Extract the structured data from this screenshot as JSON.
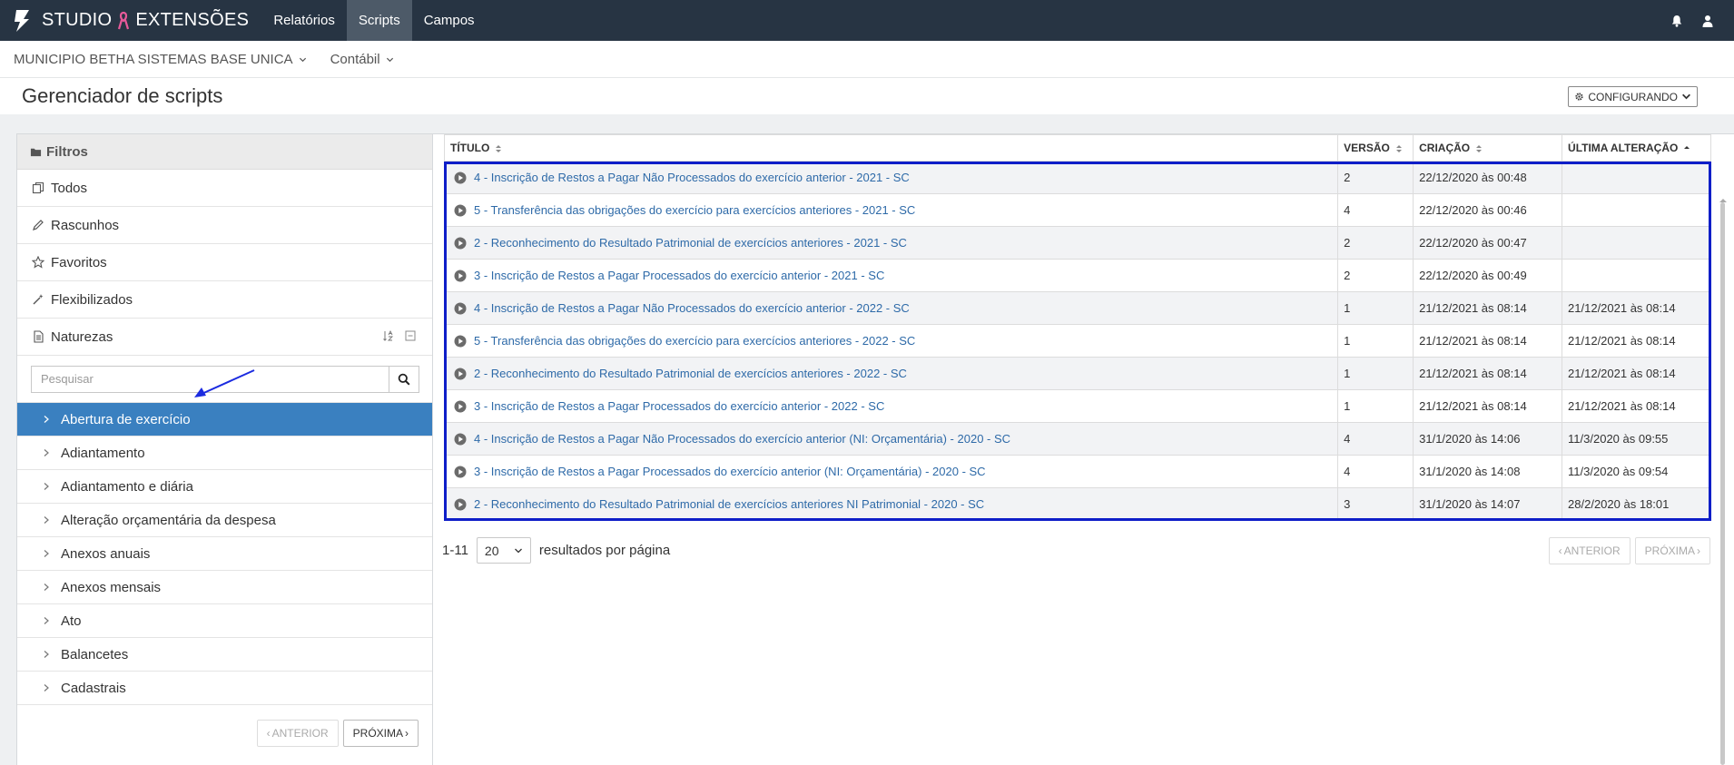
{
  "app": {
    "brand_left": "STUDIO",
    "brand_right": "EXTENSÕES",
    "nav": [
      {
        "label": "Relatórios",
        "active": false
      },
      {
        "label": "Scripts",
        "active": true
      },
      {
        "label": "Campos",
        "active": false
      }
    ]
  },
  "context": {
    "entity": "MUNICIPIO BETHA SISTEMAS BASE UNICA",
    "system": "Contábil"
  },
  "page": {
    "title": "Gerenciador de scripts",
    "config_label": "CONFIGURANDO"
  },
  "sidebar": {
    "header": "Filtros",
    "items": [
      {
        "label": "Todos",
        "icon": "copy-icon"
      },
      {
        "label": "Rascunhos",
        "icon": "pencil-icon"
      },
      {
        "label": "Favoritos",
        "icon": "star-icon"
      },
      {
        "label": "Flexibilizados",
        "icon": "wand-icon"
      },
      {
        "label": "Naturezas",
        "icon": "file-icon"
      }
    ],
    "search_placeholder": "Pesquisar",
    "tree": [
      {
        "label": "Abertura de exercício",
        "selected": true
      },
      {
        "label": "Adiantamento",
        "selected": false
      },
      {
        "label": "Adiantamento e diária",
        "selected": false
      },
      {
        "label": "Alteração orçamentária da despesa",
        "selected": false
      },
      {
        "label": "Anexos anuais",
        "selected": false
      },
      {
        "label": "Anexos mensais",
        "selected": false
      },
      {
        "label": "Ato",
        "selected": false
      },
      {
        "label": "Balancetes",
        "selected": false
      },
      {
        "label": "Cadastrais",
        "selected": false
      }
    ],
    "pager": {
      "prev": "ANTERIOR",
      "next": "PRÓXIMA"
    }
  },
  "table": {
    "columns": [
      "TÍTULO",
      "VERSÃO",
      "CRIAÇÃO",
      "ÚLTIMA ALTERAÇÃO"
    ],
    "rows": [
      {
        "title": "4 - Inscrição de Restos a Pagar Não Processados do exercício anterior - 2021 - SC",
        "version": "2",
        "created": "22/12/2020 às 00:48",
        "modified": ""
      },
      {
        "title": "5 - Transferência das obrigações do exercício para exercícios anteriores - 2021 - SC",
        "version": "4",
        "created": "22/12/2020 às 00:46",
        "modified": ""
      },
      {
        "title": "2 - Reconhecimento do Resultado Patrimonial de exercícios anteriores - 2021 - SC",
        "version": "2",
        "created": "22/12/2020 às 00:47",
        "modified": ""
      },
      {
        "title": "3 - Inscrição de Restos a Pagar Processados do exercício anterior - 2021 - SC",
        "version": "2",
        "created": "22/12/2020 às 00:49",
        "modified": ""
      },
      {
        "title": "4 - Inscrição de Restos a Pagar Não Processados do exercício anterior - 2022 - SC",
        "version": "1",
        "created": "21/12/2021 às 08:14",
        "modified": "21/12/2021 às 08:14"
      },
      {
        "title": "5 - Transferência das obrigações do exercício para exercícios anteriores - 2022 - SC",
        "version": "1",
        "created": "21/12/2021 às 08:14",
        "modified": "21/12/2021 às 08:14"
      },
      {
        "title": "2 - Reconhecimento do Resultado Patrimonial de exercícios anteriores - 2022 - SC",
        "version": "1",
        "created": "21/12/2021 às 08:14",
        "modified": "21/12/2021 às 08:14"
      },
      {
        "title": "3 - Inscrição de Restos a Pagar Processados do exercício anterior - 2022 - SC",
        "version": "1",
        "created": "21/12/2021 às 08:14",
        "modified": "21/12/2021 às 08:14"
      },
      {
        "title": "4 - Inscrição de Restos a Pagar Não Processados do exercício anterior (NI: Orçamentária) - 2020 - SC",
        "version": "4",
        "created": "31/1/2020 às 14:06",
        "modified": "11/3/2020 às 09:55"
      },
      {
        "title": "3 - Inscrição de Restos a Pagar Processados do exercício anterior (NI: Orçamentária) - 2020 - SC",
        "version": "4",
        "created": "31/1/2020 às 14:08",
        "modified": "11/3/2020 às 09:54"
      },
      {
        "title": "2 - Reconhecimento do Resultado Patrimonial de exercícios anteriores NI Patrimonial - 2020 - SC",
        "version": "3",
        "created": "31/1/2020 às 14:07",
        "modified": "28/2/2020 às 18:01"
      }
    ],
    "range": "1-11",
    "per_page": "20",
    "per_page_label": "resultados por página",
    "pager": {
      "prev": "ANTERIOR",
      "next": "PRÓXIMA"
    }
  },
  "colors": {
    "topbar": "#273443",
    "selected": "#3a80c0",
    "link": "#2e6aa8",
    "highlight": "#0e1ec8",
    "ribbon": "#e85a9a"
  }
}
